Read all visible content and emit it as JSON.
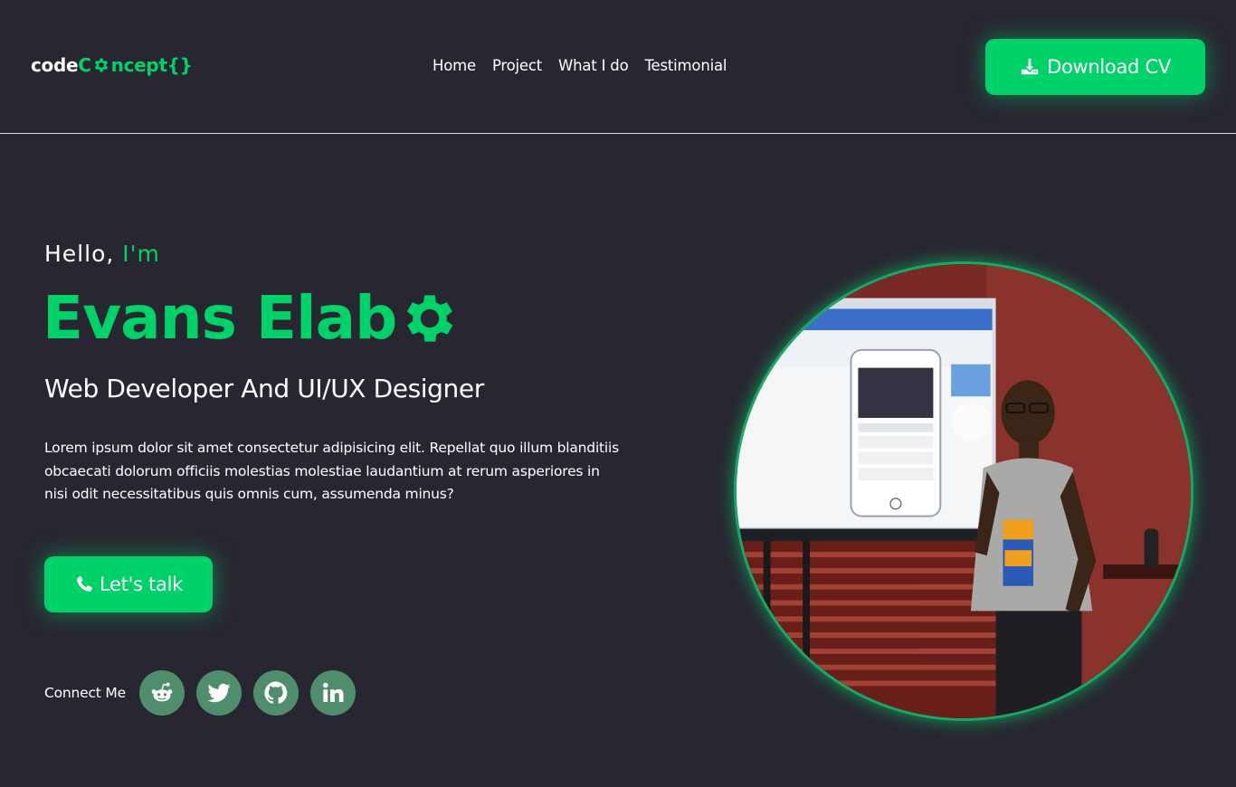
{
  "header": {
    "logo": {
      "part1": "code",
      "part2": "C",
      "part3": "ncept{}"
    },
    "nav": [
      "Home",
      "Project",
      "What I do",
      "Testimonial"
    ],
    "download_label": "Download CV"
  },
  "hero": {
    "hello": "Hello,",
    "im": "I'm",
    "name": "Evans Elab",
    "role": "Web Developer And UI/UX Designer",
    "bio": "Lorem ipsum dolor sit amet consectetur adipisicing elit. Repellat quo illum blanditiis obcaecati dolorum officiis molestias molestiae laudantium at rerum asperiores in nisi odit necessitatibus quis omnis cum, assumenda minus?",
    "talk_label": "Let's talk",
    "connect_label": "Connect Me",
    "socials": [
      "reddit-icon",
      "twitter-icon",
      "github-icon",
      "linkedin-icon"
    ]
  },
  "colors": {
    "background": "#282731",
    "accent": "#00d26a",
    "social_bg": "#4f8d6c"
  }
}
